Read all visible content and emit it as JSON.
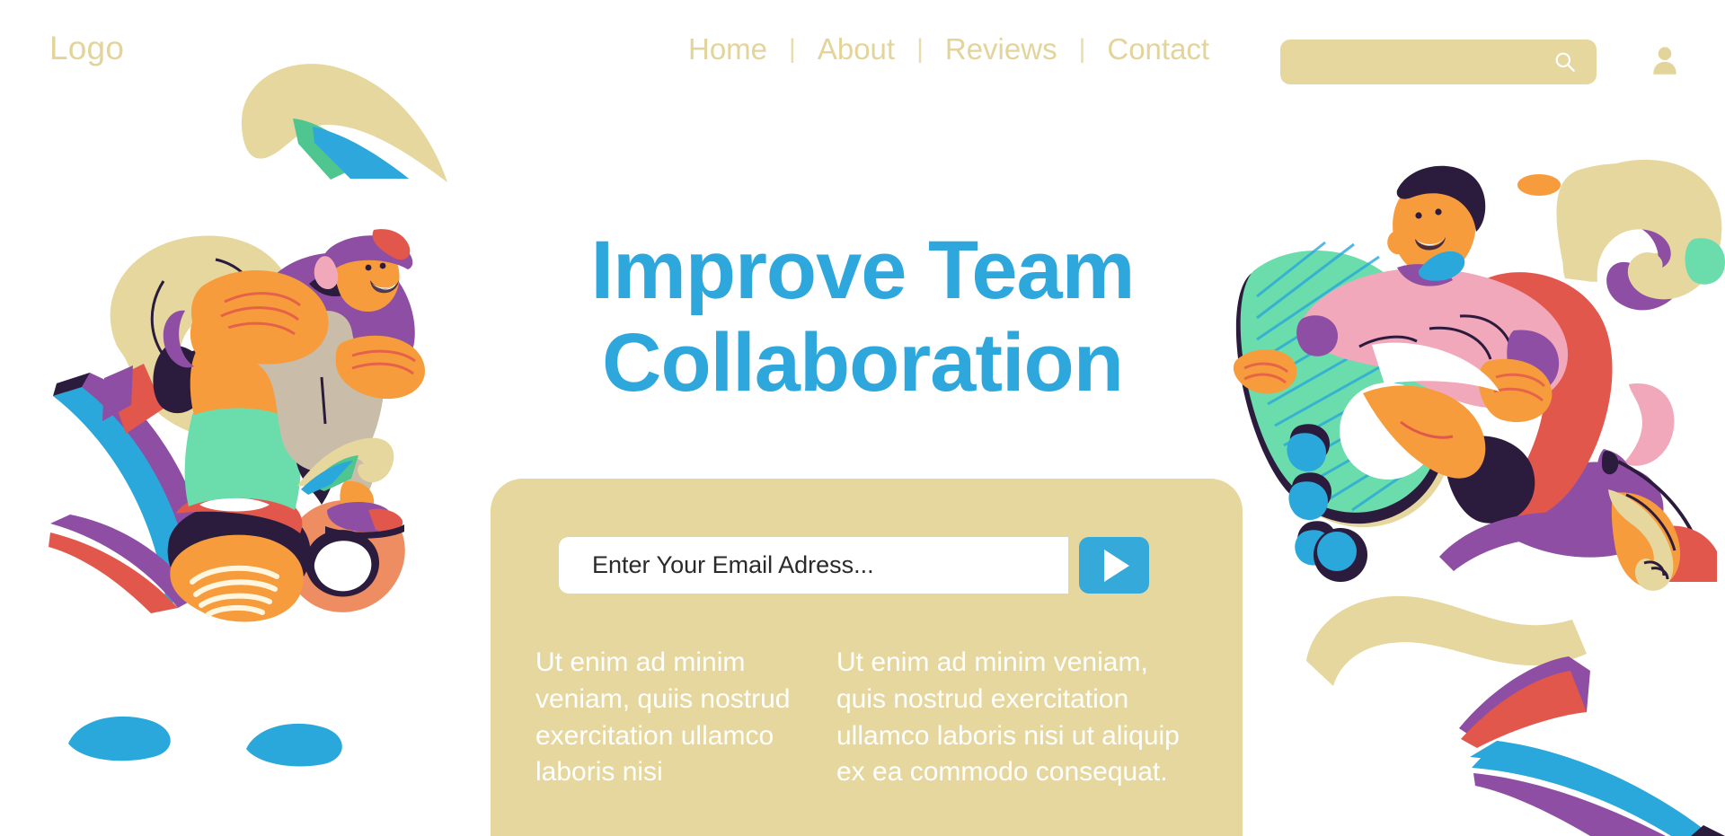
{
  "brand": {
    "logo_text": "Logo",
    "colors": {
      "accent_blue": "#2ea7dc",
      "beige": "#e6d79e",
      "nav_text": "#e3d49b",
      "card_text": "#ffffff",
      "page_background": "#ffffff"
    }
  },
  "nav": {
    "items": [
      {
        "label": "Home"
      },
      {
        "label": "About"
      },
      {
        "label": "Reviews"
      },
      {
        "label": "Contact"
      }
    ],
    "separator": "|",
    "search": {
      "value": "",
      "placeholder": "",
      "icon": "search-icon"
    },
    "account": {
      "icon": "user-icon"
    }
  },
  "hero": {
    "headline_line1": "Improve Team",
    "headline_line2": "Collaboration"
  },
  "signup": {
    "email": {
      "value": "",
      "placeholder": "Enter Your Email Adress..."
    },
    "submit": {
      "label": "",
      "icon": "play-triangle-icon"
    },
    "body_left": "Ut enim ad minim veniam, quiis nostrud exercitation ullamco laboris nisi",
    "body_right": "Ut enim ad minim veniam, quis nostrud exercitation ullamco laboris nisi ut aliquip ex ea commodo consequat."
  },
  "illustrations": {
    "left": "seated-skateboarder-illustration",
    "right": "jumping-skateboarder-illustration",
    "decor": "abstract-color-shapes"
  }
}
